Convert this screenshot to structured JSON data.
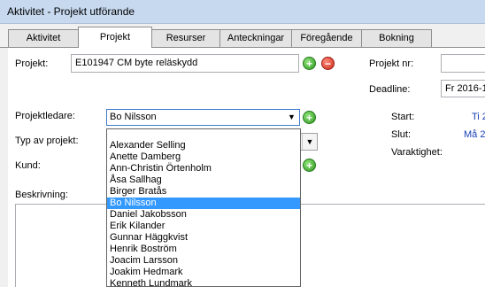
{
  "window": {
    "title": "Aktivitet - Projekt utförande"
  },
  "tabs": [
    {
      "label": "Aktivitet"
    },
    {
      "label": "Projekt"
    },
    {
      "label": "Resurser"
    },
    {
      "label": "Anteckningar"
    },
    {
      "label": "Föregående"
    },
    {
      "label": "Bokning"
    }
  ],
  "form": {
    "project_label": "Projekt:",
    "project_value": "E101947 CM byte reläskydd",
    "project_nr_label": "Projekt nr:",
    "project_nr_value": "",
    "deadline_label": "Deadline:",
    "deadline_value": "Fr 2016-1",
    "leader_label": "Projektledare:",
    "leader_value": "Bo Nilsson",
    "type_label": "Typ av projekt:",
    "customer_label": "Kund:",
    "description_label": "Beskrivning:",
    "start_label": "Start:",
    "start_value": "Ti 2",
    "end_label": "Slut:",
    "end_value": "Må 2",
    "duration_label": "Varaktighet:"
  },
  "dropdown": {
    "selected": "Bo Nilsson",
    "items": [
      "",
      "Alexander Selling",
      "Anette Damberg",
      "Ann-Christin Örtenholm",
      "Åsa Sallhag",
      "Birger Bratås",
      "Bo Nilsson",
      "Daniel Jakobsson",
      "Erik Kilander",
      "Gunnar Häggkvist",
      "Henrik Boström",
      "Joacim Larsson",
      "Joakim Hedmark",
      "Kenneth Lundmark"
    ]
  },
  "icons": {
    "add": "plus-circle-green",
    "remove": "minus-circle-red",
    "dropdown_arrow": "chevron-down"
  }
}
